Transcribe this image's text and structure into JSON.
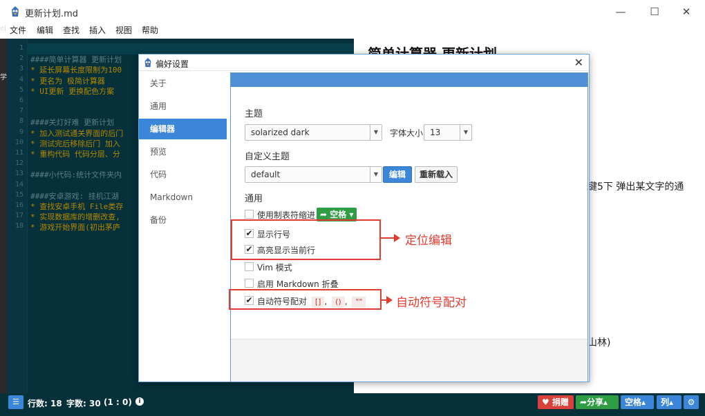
{
  "window": {
    "title": "更新计划.md",
    "minimize": "—",
    "maximize": "☐",
    "close": "✕"
  },
  "menu": [
    "文件",
    "编辑",
    "查找",
    "插入",
    "视图",
    "帮助"
  ],
  "editor": {
    "lines": [
      {
        "n": "1",
        "text": ""
      },
      {
        "n": "2",
        "text": "####简单计算器 更新计划",
        "kind": "head"
      },
      {
        "n": "3",
        "text": "* 延长屏幕长度限制为100",
        "kind": "item"
      },
      {
        "n": "4",
        "text": "* 更名为 极简计算器",
        "kind": "item"
      },
      {
        "n": "5",
        "text": "* UI更新 更换配色方案",
        "kind": "item"
      },
      {
        "n": "6",
        "text": ""
      },
      {
        "n": "7",
        "text": ""
      },
      {
        "n": "8",
        "text": "####关灯好难 更新计划",
        "kind": "head"
      },
      {
        "n": "9",
        "text": "* 加入测试通关界面的后门",
        "kind": "item"
      },
      {
        "n": "10",
        "text": "* 测试完后移除后门 加入",
        "kind": "item"
      },
      {
        "n": "11",
        "text": "* 重构代码 代码分层、分",
        "kind": "item"
      },
      {
        "n": "12",
        "text": ""
      },
      {
        "n": "13",
        "text": "####小代码:统计文件夹内",
        "kind": "head"
      },
      {
        "n": "14",
        "text": ""
      },
      {
        "n": "15",
        "text": "####安卓游戏: 挂机江湖",
        "kind": "head"
      },
      {
        "n": "16",
        "text": "* 查找安卓手机 File类存",
        "kind": "item"
      },
      {
        "n": "17",
        "text": "* 实现数据库的增删改查,",
        "kind": "item"
      },
      {
        "n": "18",
        "text": "* 游戏开始界面(初出茅庐",
        "kind": "item"
      }
    ],
    "strip_chars": [
      "e[",
      "学"
    ]
  },
  "preview": {
    "heading": "简单计算器 更新计划",
    "fragment1": "键5下 弹出某文字的通",
    "fragment2": "山林)"
  },
  "status": {
    "lines": "行数: 18",
    "chars": "字数: 30",
    "cursor": "(1 : 0)",
    "info": "i",
    "donate": "♥ 捐赠",
    "share": "➦分享▴",
    "space": "空格▴",
    "col": "列▴",
    "gear": "⚙"
  },
  "dialog": {
    "title": "偏好设置",
    "close": "✕",
    "sidebar": [
      "关于",
      "通用",
      "编辑器",
      "预览",
      "代码",
      "Markdown",
      "备份"
    ],
    "active_index": 2,
    "theme_label": "主题",
    "theme_value": "solarized dark",
    "font_size_label": "字体大小",
    "font_size_value": "13",
    "custom_theme_label": "自定义主题",
    "custom_theme_value": "default",
    "edit_button": "编辑",
    "reload_button": "重新载入",
    "general_label": "通用",
    "tab_indent_label": "使用制表符缩进",
    "space_button": "➦ 空格 ▾",
    "show_line_numbers": "显示行号",
    "highlight_line": "高亮显示当前行",
    "vim_mode": "Vim 模式",
    "md_fold": "启用 Markdown 折叠",
    "auto_pair": "自动符号配对",
    "pair_1": "[]",
    "pair_2": "()",
    "pair_3": "\"\"",
    "pair_sep": ","
  },
  "annotations": {
    "locate": "定位编辑",
    "autopair": "自动符号配对"
  },
  "colors": {
    "accent": "#3b86d8",
    "editor_bg": "#06303a",
    "annotation": "#e23b2f",
    "green": "#2e9d43",
    "red": "#d9413a"
  }
}
